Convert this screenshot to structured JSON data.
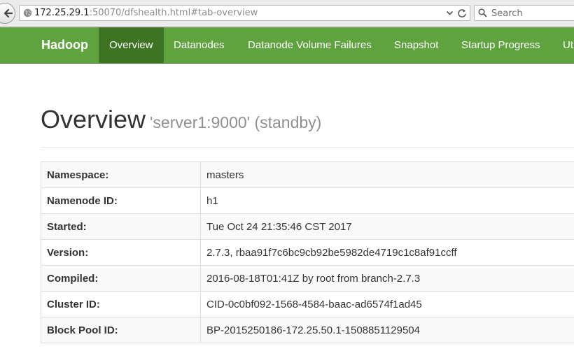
{
  "browser": {
    "url_host": "172.25.29.1",
    "url_rest": ":50070/dfshealth.html#tab-overview",
    "search_placeholder": "Search"
  },
  "navbar": {
    "brand": "Hadoop",
    "items": [
      {
        "label": "Overview",
        "active": true
      },
      {
        "label": "Datanodes",
        "active": false
      },
      {
        "label": "Datanode Volume Failures",
        "active": false
      },
      {
        "label": "Snapshot",
        "active": false
      },
      {
        "label": "Startup Progress",
        "active": false
      },
      {
        "label": "Ut",
        "active": false
      }
    ]
  },
  "header": {
    "title": "Overview",
    "subtitle": "'server1:9000' (standby)"
  },
  "overview_table": [
    {
      "key": "Namespace:",
      "value": "masters"
    },
    {
      "key": "Namenode ID:",
      "value": "h1"
    },
    {
      "key": "Started:",
      "value": "Tue Oct 24 21:35:46 CST 2017"
    },
    {
      "key": "Version:",
      "value": "2.7.3, rbaa91f7c6bc9cb92be5982de4719c1c8af91ccff"
    },
    {
      "key": "Compiled:",
      "value": "2016-08-18T01:41Z by root from branch-2.7.3"
    },
    {
      "key": "Cluster ID:",
      "value": "CID-0c0bf092-1568-4584-baac-ad6574f1ad45"
    },
    {
      "key": "Block Pool ID:",
      "value": "BP-2015250186-172.25.50.1-1508851129504"
    }
  ],
  "colors": {
    "navbar": "#5fa33e",
    "navbar_active": "#3d7322"
  }
}
